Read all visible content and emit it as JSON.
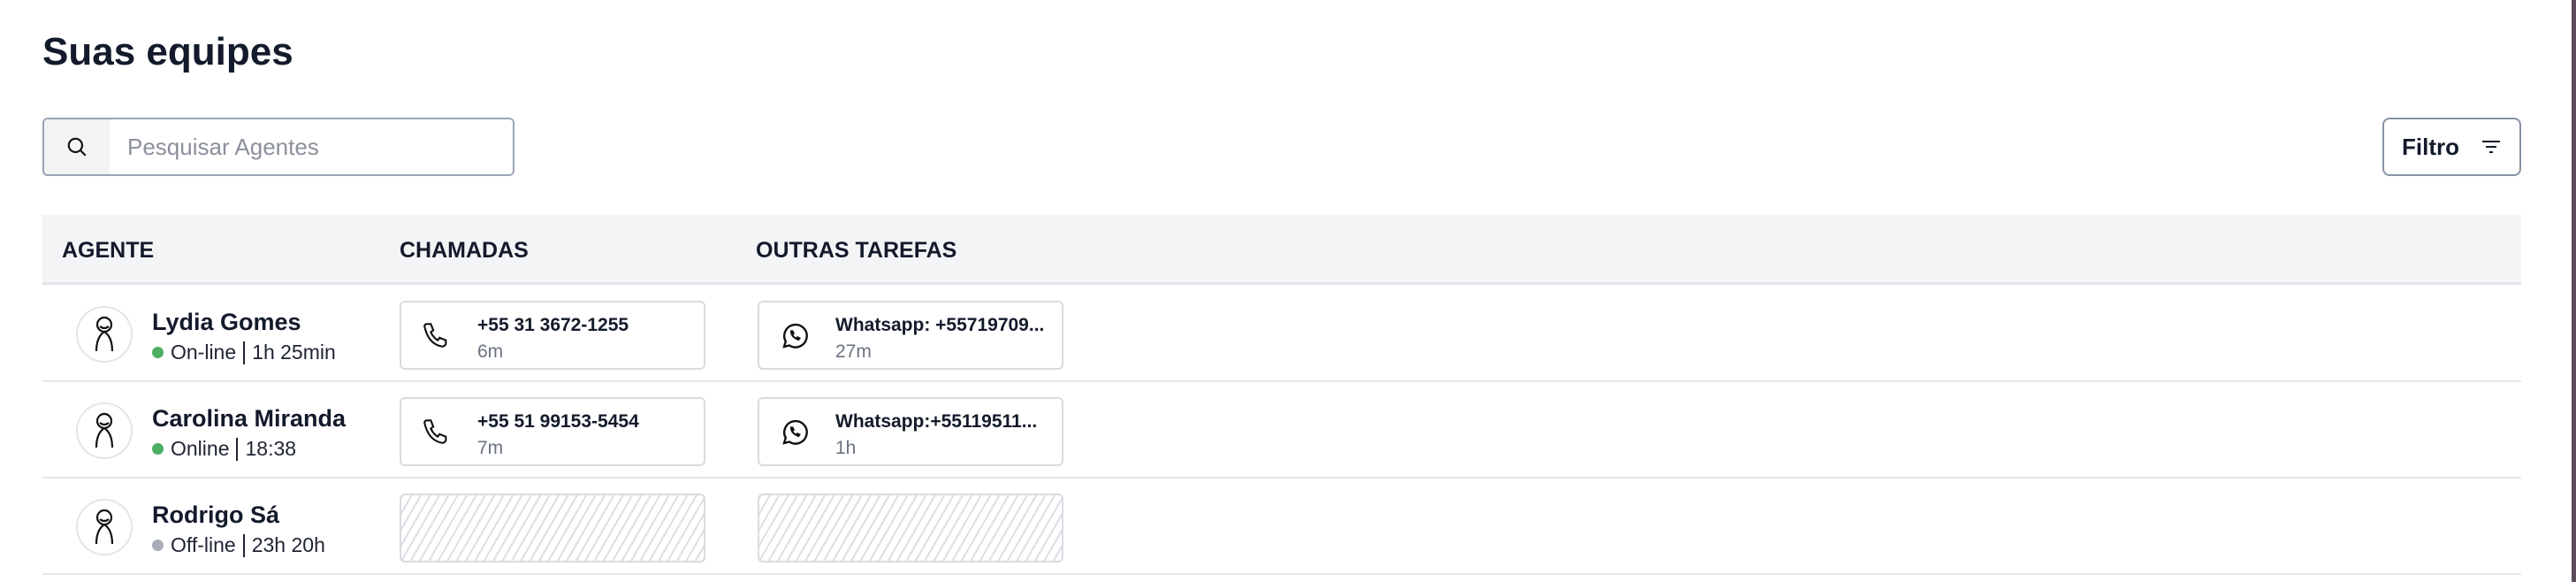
{
  "title": "Suas equipes",
  "search": {
    "placeholder": "Pesquisar Agentes",
    "value": ""
  },
  "filter_label": "Filtro",
  "columns": [
    "AGENTE",
    "CHAMADAS",
    "OUTRAS TAREFAS"
  ],
  "colors": {
    "online": "#4caf62",
    "offline": "#a9adb8"
  },
  "agents": [
    {
      "name": "Lydia Gomes",
      "status": "On-line",
      "duration": "1h 25min",
      "call": {
        "number": "+55 31 3672-1255",
        "time": "6m"
      },
      "task": {
        "label": "Whatsapp: +55719709...",
        "time": "27m"
      }
    },
    {
      "name": "Carolina Miranda",
      "status": "Online",
      "duration": "18:38",
      "call": {
        "number": "+55 51 99153-5454",
        "time": "7m"
      },
      "task": {
        "label": "Whatsapp:+55119511...",
        "time": "1h"
      }
    },
    {
      "name": "Rodrigo Sá",
      "status": "Off-line",
      "duration": "23h 20h"
    }
  ]
}
